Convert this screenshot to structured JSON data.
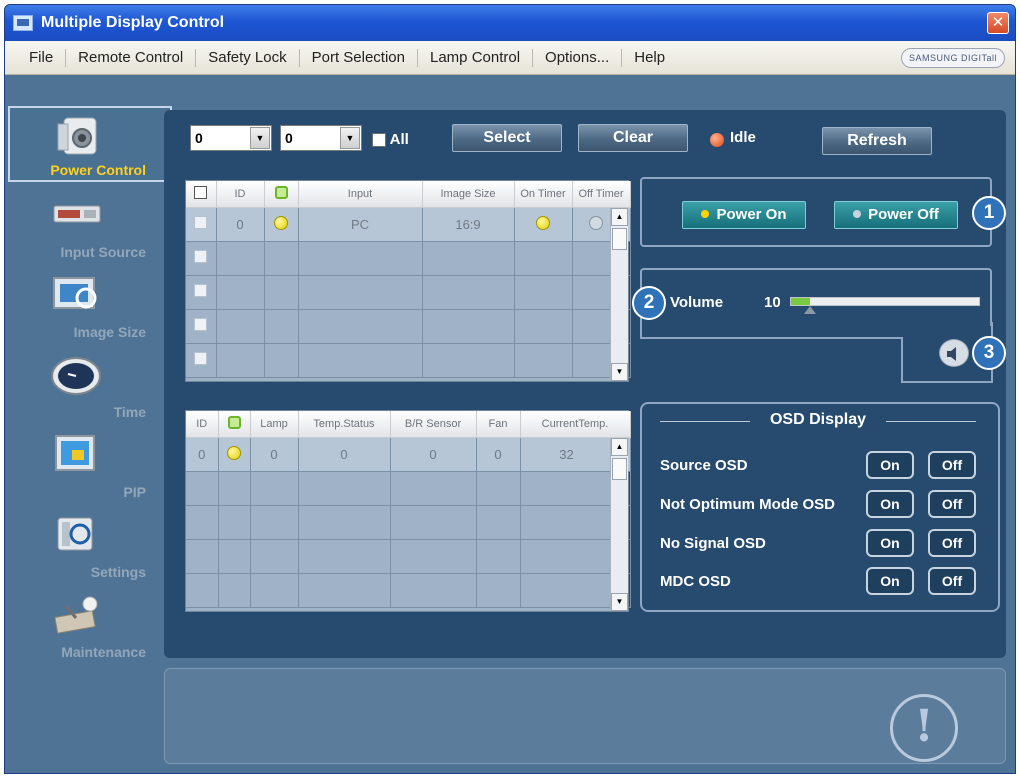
{
  "window": {
    "title": "Multiple Display Control",
    "close_symbol": "✕",
    "brand": "SAMSUNG DIGITall"
  },
  "menu": [
    "File",
    "Remote Control",
    "Safety Lock",
    "Port Selection",
    "Lamp Control",
    "Options...",
    "Help"
  ],
  "nav": {
    "items": [
      {
        "label": "Power Control",
        "icon": "power-control-icon",
        "active": true
      },
      {
        "label": "Input Source",
        "icon": "input-source-icon",
        "active": false
      },
      {
        "label": "Image Size",
        "icon": "image-size-icon",
        "active": false
      },
      {
        "label": "Time",
        "icon": "clock-icon",
        "active": false
      },
      {
        "label": "PIP",
        "icon": "pip-icon",
        "active": false
      },
      {
        "label": "Settings",
        "icon": "settings-icon",
        "active": false
      },
      {
        "label": "Maintenance",
        "icon": "maintenance-icon",
        "active": false
      }
    ]
  },
  "toolbar": {
    "combo1_value": "0",
    "combo2_value": "0",
    "all_label": "All",
    "select_label": "Select",
    "clear_label": "Clear",
    "status_label": "Idle",
    "refresh_label": "Refresh"
  },
  "grid_top": {
    "headers": [
      "",
      "ID",
      "",
      "Input",
      "Image Size",
      "On Timer",
      "Off Timer"
    ],
    "rows": [
      {
        "id": "0",
        "input": "PC",
        "image_size": "16:9",
        "selected": true
      },
      {
        "id": "",
        "input": "",
        "image_size": "",
        "selected": false
      },
      {
        "id": "",
        "input": "",
        "image_size": "",
        "selected": false
      },
      {
        "id": "",
        "input": "",
        "image_size": "",
        "selected": false
      },
      {
        "id": "",
        "input": "",
        "image_size": "",
        "selected": false
      }
    ]
  },
  "grid_bottom": {
    "headers": [
      "ID",
      "",
      "Lamp",
      "Temp.Status",
      "B/R Sensor",
      "Fan",
      "CurrentTemp."
    ],
    "rows": [
      {
        "id": "0",
        "lamp": "0",
        "temp_status": "0",
        "br_sensor": "0",
        "fan": "0",
        "current_temp": "32"
      },
      {
        "id": "",
        "lamp": "",
        "temp_status": "",
        "br_sensor": "",
        "fan": "",
        "current_temp": ""
      },
      {
        "id": "",
        "lamp": "",
        "temp_status": "",
        "br_sensor": "",
        "fan": "",
        "current_temp": ""
      },
      {
        "id": "",
        "lamp": "",
        "temp_status": "",
        "br_sensor": "",
        "fan": "",
        "current_temp": ""
      },
      {
        "id": "",
        "lamp": "",
        "temp_status": "",
        "br_sensor": "",
        "fan": "",
        "current_temp": ""
      }
    ]
  },
  "power": {
    "on_label": "Power On",
    "off_label": "Power Off",
    "on_led": "#ffd400",
    "off_led": "#c8d4df"
  },
  "volume": {
    "label": "Volume",
    "value": "10",
    "level": 10,
    "max": 100
  },
  "badges": [
    "1",
    "2",
    "3"
  ],
  "osd": {
    "title": "OSD Display",
    "rows": [
      {
        "label": "Source OSD",
        "on": "On",
        "off": "Off"
      },
      {
        "label": "Not Optimum Mode OSD",
        "on": "On",
        "off": "Off"
      },
      {
        "label": "No Signal OSD",
        "on": "On",
        "off": "Off"
      },
      {
        "label": "MDC OSD",
        "on": "On",
        "off": "Off"
      }
    ]
  },
  "info_symbol": "!"
}
